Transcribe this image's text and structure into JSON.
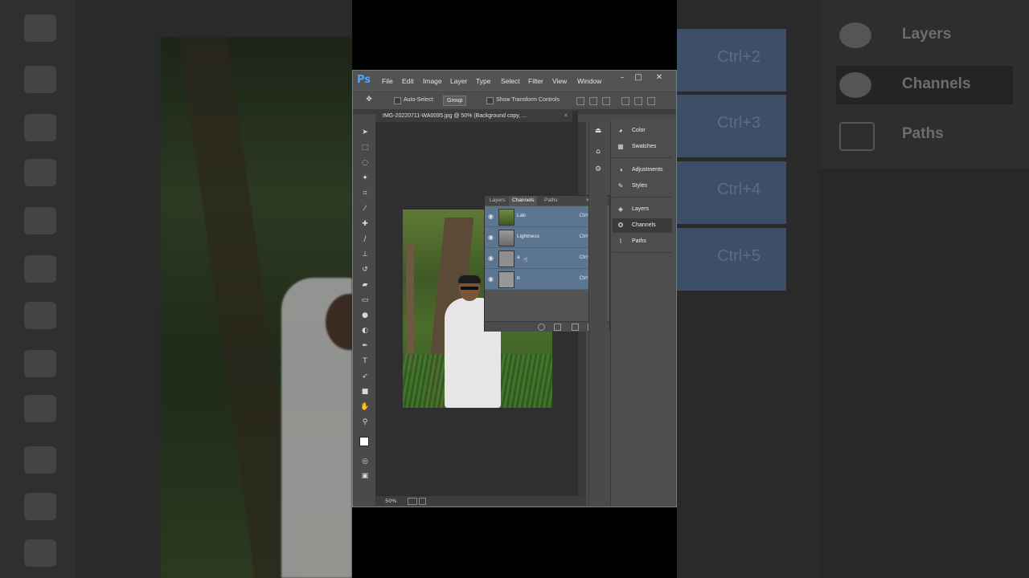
{
  "app": {
    "logo": "Ps"
  },
  "menu": [
    "File",
    "Edit",
    "Image",
    "Layer",
    "Type",
    "Select",
    "Filter",
    "View",
    "Window"
  ],
  "window_controls": {
    "minimize": "–",
    "maximize": "□",
    "close": "✕"
  },
  "options": {
    "auto_select_label": "Auto-Select:",
    "group_value": "Group",
    "transform_label": "Show Transform Controls"
  },
  "document": {
    "tab_title": "IMG-20220711-WA0095.jpg @ 50% (Background copy, ...",
    "close": "×",
    "zoom": "50%"
  },
  "channels_panel": {
    "tabs": [
      "Layers",
      "Channels",
      "Paths"
    ],
    "active_tab": "Channels",
    "rows": [
      {
        "name": "Lab",
        "shortcut": "Ctrl+2"
      },
      {
        "name": "Lightness",
        "shortcut": "Ctrl+3"
      },
      {
        "name": "a",
        "shortcut": "Ctrl+4"
      },
      {
        "name": "b",
        "shortcut": "Ctrl+5"
      }
    ]
  },
  "dock": {
    "items": [
      {
        "label": "Color",
        "icon": "color-icon"
      },
      {
        "label": "Swatches",
        "icon": "swatches-icon"
      },
      {
        "label": "Adjustments",
        "icon": "adjustments-icon"
      },
      {
        "label": "Styles",
        "icon": "styles-icon"
      },
      {
        "label": "Layers",
        "icon": "layers-icon"
      },
      {
        "label": "Channels",
        "icon": "channels-icon",
        "active": true
      },
      {
        "label": "Paths",
        "icon": "paths-icon"
      }
    ]
  },
  "background_right": {
    "shortcuts": [
      "Ctrl+2",
      "Ctrl+3",
      "Ctrl+4",
      "Ctrl+5"
    ],
    "panel_items": [
      "Layers",
      "Channels",
      "Paths"
    ]
  },
  "colors": {
    "accent": "#4ea4ff",
    "selected_row": "#5c7590",
    "ui_bg": "#4a4a4a"
  }
}
